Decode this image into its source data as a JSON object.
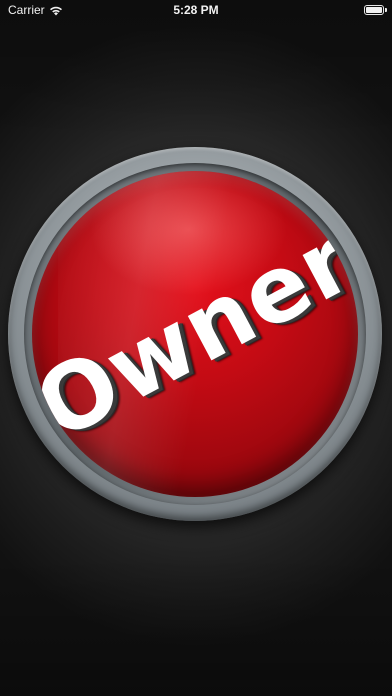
{
  "status_bar": {
    "carrier": "Carrier",
    "time": "5:28 PM",
    "wifi_icon": "wifi-icon",
    "battery_icon": "battery-icon"
  },
  "main_button": {
    "label": "Owner",
    "colors": {
      "face": "#c40b14",
      "rim": "#9aa1a5",
      "background": "#333333"
    }
  }
}
